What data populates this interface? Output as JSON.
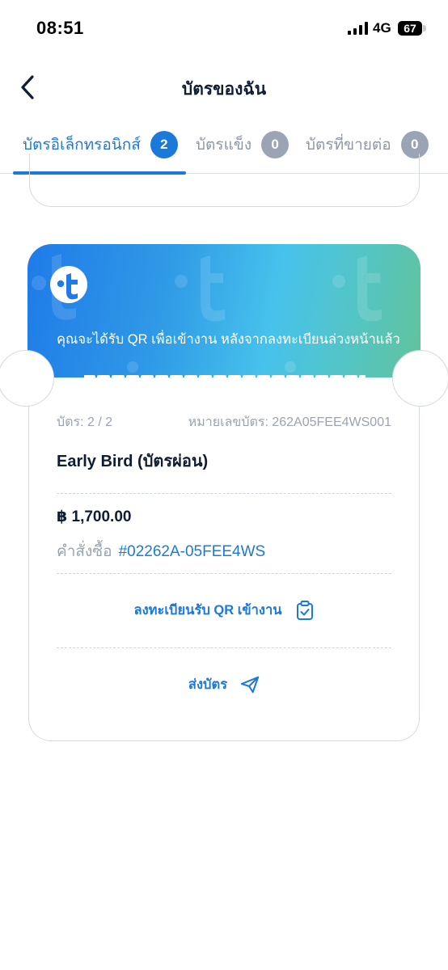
{
  "status_bar": {
    "time": "08:51",
    "network": "4G",
    "battery": "67"
  },
  "header": {
    "title": "บัตรของฉัน",
    "back_icon": "chevron-left-icon"
  },
  "tabs": [
    {
      "label": "บัตรอิเล็กทรอนิกส์",
      "count": "2",
      "active": true
    },
    {
      "label": "บัตรแข็ง",
      "count": "0",
      "active": false
    },
    {
      "label": "บัตรที่ขายต่อ",
      "count": "0",
      "active": false
    }
  ],
  "ticket": {
    "notice": "คุณจะได้รับ QR เพื่อเข้างาน หลังจากลงทะเบียนล่วงหน้าแล้ว",
    "count": "บัตร: 2 / 2",
    "number": "หมายเลขบัตร: 262A05FEE4WS001",
    "type": "Early Bird (บัตรผ่อน)",
    "price": "฿ 1,700.00",
    "order_label": "คำสั่งซื้อ",
    "order_id": "#02262A-05FEE4WS",
    "register_label": "ลงทะเบียนรับ QR เข้างาน",
    "send_label": "ส่งบัตร"
  },
  "colors": {
    "accent": "#1b79d9",
    "badge_inactive": "#9ba4b4",
    "muted_text": "#9aa3b0",
    "gradient_start": "#1f7be8",
    "gradient_end": "#62c39b"
  }
}
